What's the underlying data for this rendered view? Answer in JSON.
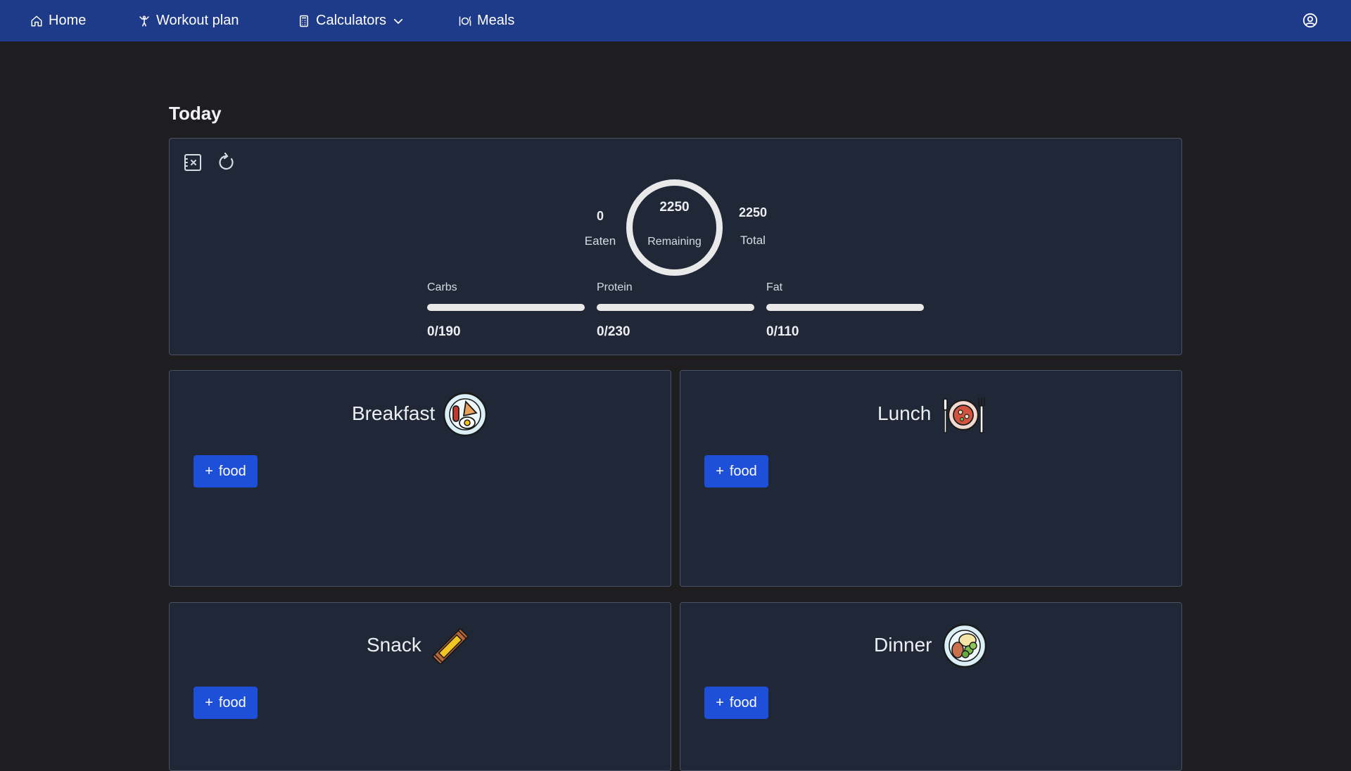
{
  "nav": {
    "home": "Home",
    "workout": "Workout plan",
    "calculators": "Calculators",
    "meals": "Meals"
  },
  "page": {
    "title": "Today"
  },
  "summary": {
    "eaten_value": "0",
    "eaten_label": "Eaten",
    "remaining_value": "2250",
    "remaining_label": "Remaining",
    "total_value": "2250",
    "total_label": "Total",
    "macros": [
      {
        "label": "Carbs",
        "value": "0/190",
        "progress": 0
      },
      {
        "label": "Protein",
        "value": "0/230",
        "progress": 0
      },
      {
        "label": "Fat",
        "value": "0/110",
        "progress": 0
      }
    ]
  },
  "meals": [
    {
      "name": "Breakfast",
      "button": "food",
      "icon": "breakfast-plate-icon"
    },
    {
      "name": "Lunch",
      "button": "food",
      "icon": "lunch-plate-icon"
    },
    {
      "name": "Snack",
      "button": "food",
      "icon": "snack-bar-icon"
    },
    {
      "name": "Dinner",
      "button": "food",
      "icon": "dinner-plate-icon"
    }
  ],
  "colors": {
    "nav_bg": "#1e3b8a",
    "page_bg": "#1e1e21",
    "card_bg": "#202838",
    "accent": "#1e4fd8"
  }
}
